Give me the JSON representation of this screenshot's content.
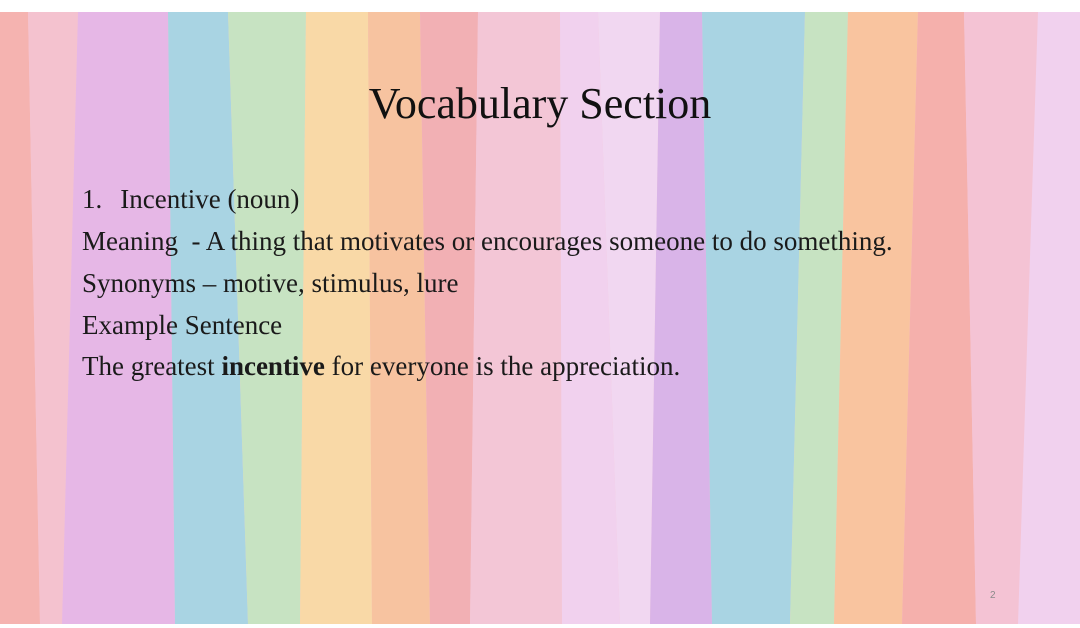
{
  "slide": {
    "title": "Vocabulary Section",
    "item": {
      "number": "1.",
      "word_with_pos": "Incentive (noun)",
      "meaning_label": "Meaning",
      "meaning_sep": "-",
      "meaning_text": "A thing that motivates or encourages someone to do something.",
      "synonyms_label": "Synonyms",
      "synonyms_sep": "–",
      "synonyms_text": "motive, stimulus, lure",
      "example_label": "Example Sentence",
      "example_before": "The greatest",
      "example_bold": "incentive",
      "example_after": "for everyone is the appreciation."
    },
    "page_number": "2"
  },
  "colors": {
    "stripe_palette": [
      "#f5b3b0",
      "#e6b7e6",
      "#a9d4e3",
      "#c7e3c2",
      "#f9d9a7",
      "#f7c3a0",
      "#f2b6bf",
      "#f3c6d6",
      "#f1d1ee",
      "#d9b4e8"
    ]
  }
}
